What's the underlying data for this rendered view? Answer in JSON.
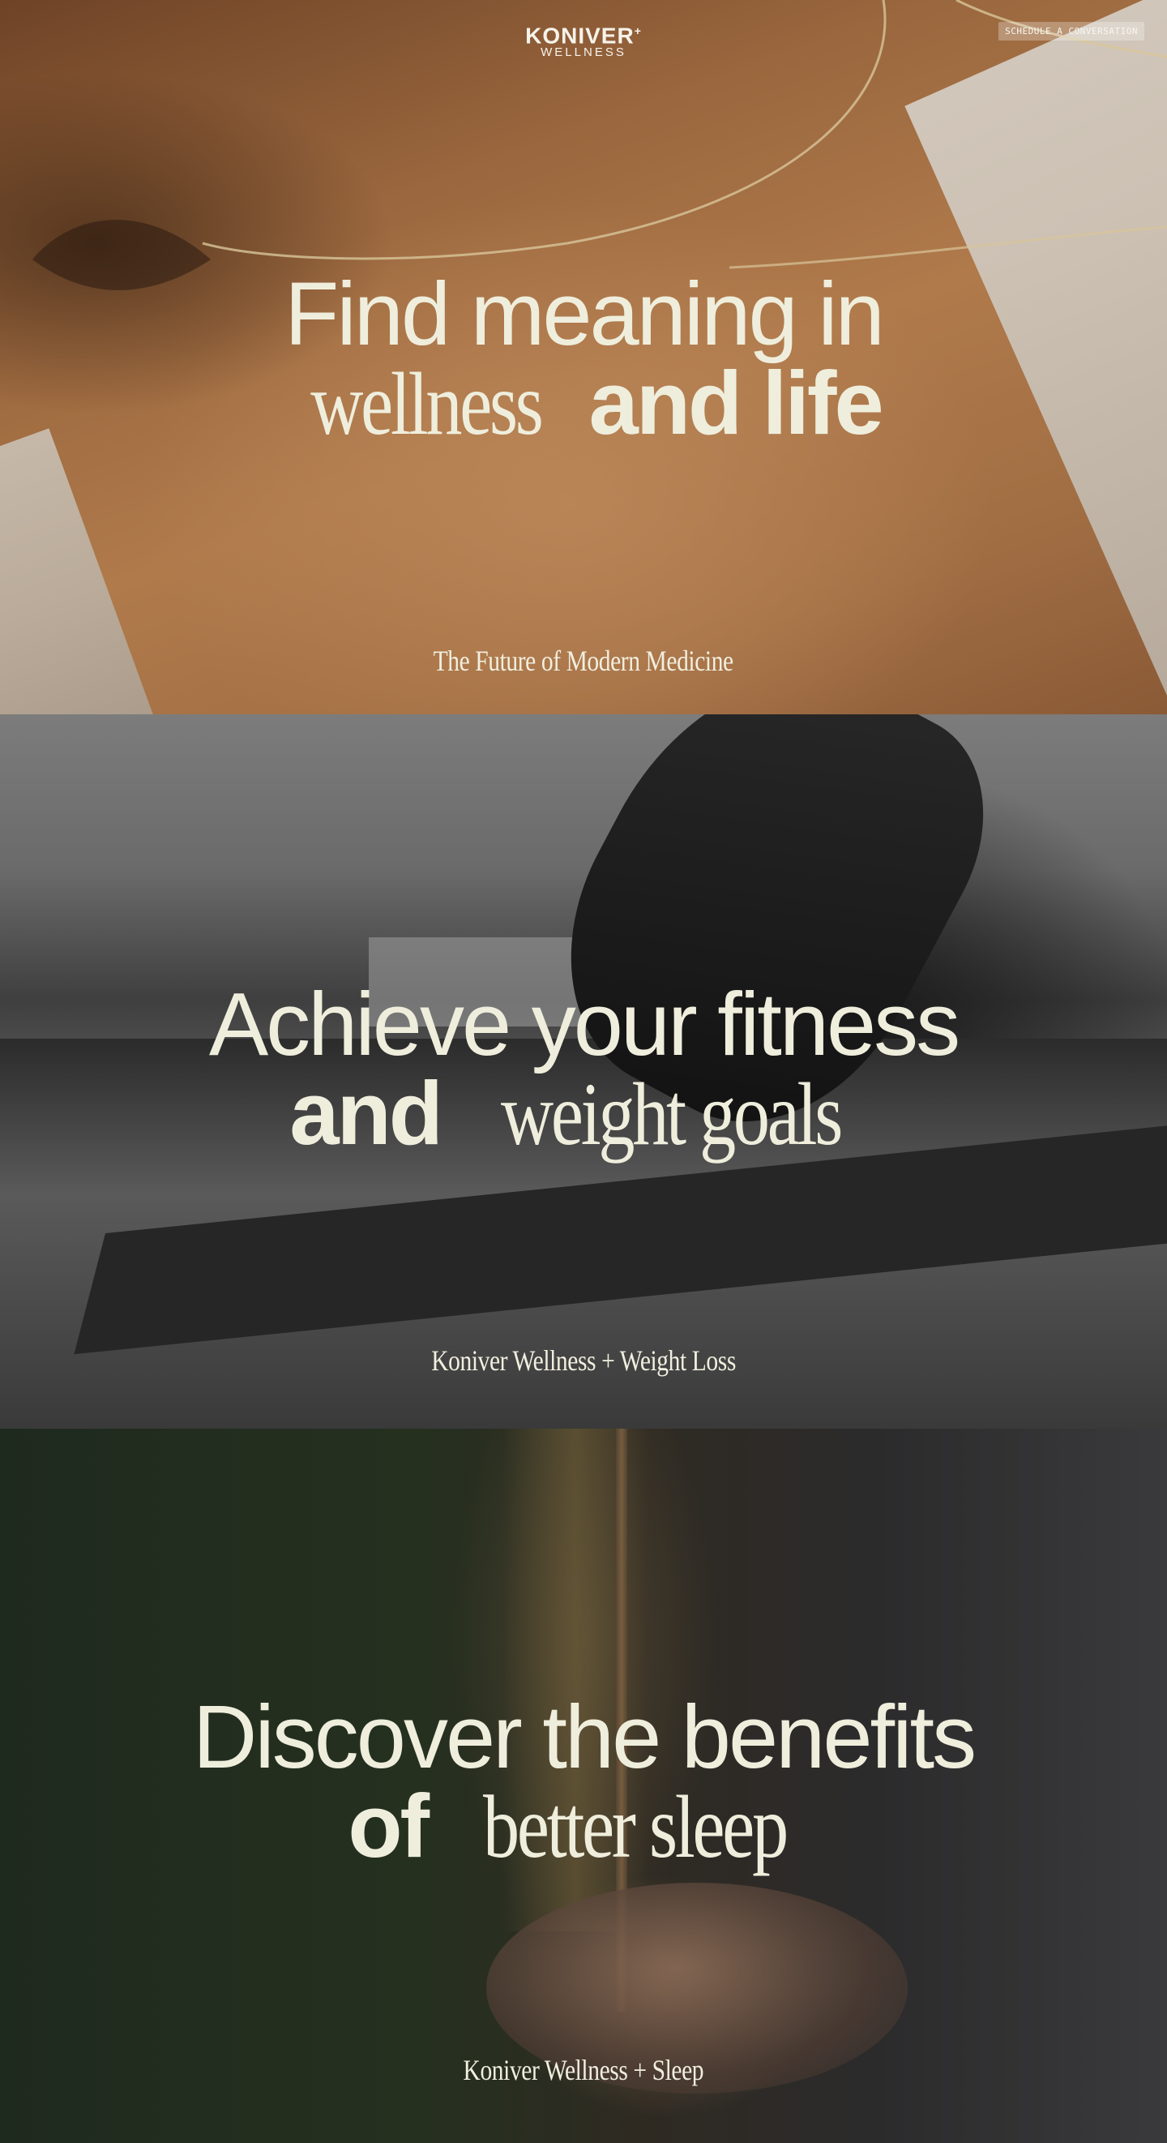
{
  "header": {
    "logo_main": "KONIVER",
    "logo_star": "+",
    "logo_sub": "WELLNESS",
    "cta_label": "SCHEDULE A CONVERSATION"
  },
  "sections": [
    {
      "line1": "Find meaning in",
      "line2_serif": "wellness",
      "line2_sans": "and life",
      "tagline": "The Future of Modern Medicine"
    },
    {
      "line1": "Achieve your fitness",
      "line2_sans": "and",
      "line2_serif": "weight goals",
      "tagline": "Koniver Wellness + Weight Loss"
    },
    {
      "line1": "Discover the benefits",
      "line2_sans": "of",
      "line2_serif": "better sleep",
      "tagline": "Koniver Wellness + Sleep"
    }
  ]
}
